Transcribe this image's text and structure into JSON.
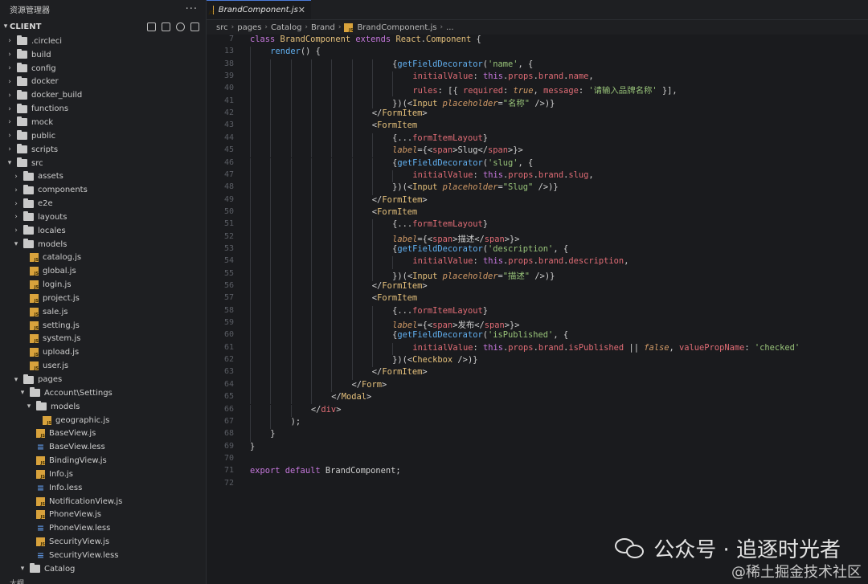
{
  "explorer": {
    "title": "资源管理器",
    "more": "···",
    "section": "CLIENT",
    "tree": [
      {
        "label": ".circleci",
        "type": "folder",
        "level": 0,
        "expanded": false
      },
      {
        "label": "build",
        "type": "folder",
        "level": 0,
        "expanded": false
      },
      {
        "label": "config",
        "type": "folder",
        "level": 0,
        "expanded": false
      },
      {
        "label": "docker",
        "type": "folder",
        "level": 0,
        "expanded": false
      },
      {
        "label": "docker_build",
        "type": "folder",
        "level": 0,
        "expanded": false
      },
      {
        "label": "functions",
        "type": "folder",
        "level": 0,
        "expanded": false
      },
      {
        "label": "mock",
        "type": "folder",
        "level": 0,
        "expanded": false
      },
      {
        "label": "public",
        "type": "folder",
        "level": 0,
        "expanded": false
      },
      {
        "label": "scripts",
        "type": "folder",
        "level": 0,
        "expanded": false
      },
      {
        "label": "src",
        "type": "folder",
        "level": 0,
        "expanded": true
      },
      {
        "label": "assets",
        "type": "folder",
        "level": 1,
        "expanded": false
      },
      {
        "label": "components",
        "type": "folder",
        "level": 1,
        "expanded": false
      },
      {
        "label": "e2e",
        "type": "folder",
        "level": 1,
        "expanded": false
      },
      {
        "label": "layouts",
        "type": "folder",
        "level": 1,
        "expanded": false
      },
      {
        "label": "locales",
        "type": "folder",
        "level": 1,
        "expanded": false
      },
      {
        "label": "models",
        "type": "folder",
        "level": 1,
        "expanded": true
      },
      {
        "label": "catalog.js",
        "type": "js",
        "level": 2
      },
      {
        "label": "global.js",
        "type": "js",
        "level": 2
      },
      {
        "label": "login.js",
        "type": "js",
        "level": 2
      },
      {
        "label": "project.js",
        "type": "js",
        "level": 2
      },
      {
        "label": "sale.js",
        "type": "js",
        "level": 2
      },
      {
        "label": "setting.js",
        "type": "js",
        "level": 2
      },
      {
        "label": "system.js",
        "type": "js",
        "level": 2
      },
      {
        "label": "upload.js",
        "type": "js",
        "level": 2
      },
      {
        "label": "user.js",
        "type": "js",
        "level": 2
      },
      {
        "label": "pages",
        "type": "folder",
        "level": 1,
        "expanded": true
      },
      {
        "label": "Account\\Settings",
        "type": "folder",
        "level": 2,
        "expanded": true
      },
      {
        "label": "models",
        "type": "folder",
        "level": 3,
        "expanded": true
      },
      {
        "label": "geographic.js",
        "type": "js",
        "level": 4
      },
      {
        "label": "BaseView.js",
        "type": "js",
        "level": 3
      },
      {
        "label": "BaseView.less",
        "type": "less",
        "level": 3
      },
      {
        "label": "BindingView.js",
        "type": "js",
        "level": 3
      },
      {
        "label": "Info.js",
        "type": "js",
        "level": 3
      },
      {
        "label": "Info.less",
        "type": "less",
        "level": 3
      },
      {
        "label": "NotificationView.js",
        "type": "js",
        "level": 3
      },
      {
        "label": "PhoneView.js",
        "type": "js",
        "level": 3
      },
      {
        "label": "PhoneView.less",
        "type": "less",
        "level": 3
      },
      {
        "label": "SecurityView.js",
        "type": "js",
        "level": 3
      },
      {
        "label": "SecurityView.less",
        "type": "less",
        "level": 3
      },
      {
        "label": "Catalog",
        "type": "folder",
        "level": 2,
        "expanded": true
      }
    ],
    "footer": "大纲"
  },
  "tab": {
    "label": "BrandComponent.js",
    "close": "✕"
  },
  "breadcrumb": [
    "src",
    "pages",
    "Catalog",
    "Brand",
    "BrandComponent.js",
    "..."
  ],
  "code": [
    {
      "n": "7",
      "i": 0,
      "t": [
        [
          "kw",
          "class "
        ],
        [
          "cls",
          "BrandComponent "
        ],
        [
          "kw",
          "extends "
        ],
        [
          "cls",
          "React"
        ],
        [
          "pl",
          "."
        ],
        [
          "cls",
          "Component "
        ],
        [
          "pl",
          "{"
        ]
      ]
    },
    {
      "n": "13",
      "i": 1,
      "t": [
        [
          "fn",
          "render"
        ],
        [
          "pl",
          "() {"
        ]
      ]
    },
    {
      "n": "38",
      "i": 7,
      "t": [
        [
          "pl",
          "{"
        ],
        [
          "fn",
          "getFieldDecorator"
        ],
        [
          "pl",
          "("
        ],
        [
          "str",
          "'name'"
        ],
        [
          "pl",
          ", {"
        ]
      ]
    },
    {
      "n": "39",
      "i": 8,
      "t": [
        [
          "prop",
          "initialValue"
        ],
        [
          "pl",
          ": "
        ],
        [
          "kw",
          "this"
        ],
        [
          "pl",
          "."
        ],
        [
          "prop",
          "props"
        ],
        [
          "pl",
          "."
        ],
        [
          "prop",
          "brand"
        ],
        [
          "pl",
          "."
        ],
        [
          "prop",
          "name"
        ],
        [
          "pl",
          ","
        ]
      ]
    },
    {
      "n": "40",
      "i": 8,
      "t": [
        [
          "prop",
          "rules"
        ],
        [
          "pl",
          ": [{ "
        ],
        [
          "prop",
          "required"
        ],
        [
          "pl",
          ": "
        ],
        [
          "attr",
          "true"
        ],
        [
          "pl",
          ", "
        ],
        [
          "prop",
          "message"
        ],
        [
          "pl",
          ": "
        ],
        [
          "str",
          "'请输入品牌名称'"
        ],
        [
          "pl",
          " }],"
        ]
      ]
    },
    {
      "n": "41",
      "i": 7,
      "t": [
        [
          "pl",
          "})(<"
        ],
        [
          "cls",
          "Input "
        ],
        [
          "attr",
          "placeholder"
        ],
        [
          "pl",
          "="
        ],
        [
          "str",
          "\"名称\""
        ],
        [
          "pl",
          " />)}"
        ]
      ]
    },
    {
      "n": "42",
      "i": 6,
      "t": [
        [
          "pl",
          "</"
        ],
        [
          "cls",
          "FormItem"
        ],
        [
          "pl",
          ">"
        ]
      ]
    },
    {
      "n": "43",
      "i": 6,
      "t": [
        [
          "pl",
          "<"
        ],
        [
          "cls",
          "FormItem"
        ]
      ]
    },
    {
      "n": "44",
      "i": 7,
      "t": [
        [
          "pl",
          "{..."
        ],
        [
          "prop",
          "formItemLayout"
        ],
        [
          "pl",
          "}"
        ]
      ]
    },
    {
      "n": "45",
      "i": 7,
      "t": [
        [
          "attr",
          "label"
        ],
        [
          "pl",
          "={<"
        ],
        [
          "tag",
          "span"
        ],
        [
          "pl",
          ">Slug</"
        ],
        [
          "tag",
          "span"
        ],
        [
          "pl",
          ">}>"
        ]
      ]
    },
    {
      "n": "46",
      "i": 7,
      "t": [
        [
          "pl",
          "{"
        ],
        [
          "fn",
          "getFieldDecorator"
        ],
        [
          "pl",
          "("
        ],
        [
          "str",
          "'slug'"
        ],
        [
          "pl",
          ", {"
        ]
      ]
    },
    {
      "n": "47",
      "i": 8,
      "t": [
        [
          "prop",
          "initialValue"
        ],
        [
          "pl",
          ": "
        ],
        [
          "kw",
          "this"
        ],
        [
          "pl",
          "."
        ],
        [
          "prop",
          "props"
        ],
        [
          "pl",
          "."
        ],
        [
          "prop",
          "brand"
        ],
        [
          "pl",
          "."
        ],
        [
          "prop",
          "slug"
        ],
        [
          "pl",
          ","
        ]
      ]
    },
    {
      "n": "48",
      "i": 7,
      "t": [
        [
          "pl",
          "})(<"
        ],
        [
          "cls",
          "Input "
        ],
        [
          "attr",
          "placeholder"
        ],
        [
          "pl",
          "="
        ],
        [
          "str",
          "\"Slug\""
        ],
        [
          "pl",
          " />)}"
        ]
      ]
    },
    {
      "n": "49",
      "i": 6,
      "t": [
        [
          "pl",
          "</"
        ],
        [
          "cls",
          "FormItem"
        ],
        [
          "pl",
          ">"
        ]
      ]
    },
    {
      "n": "50",
      "i": 6,
      "t": [
        [
          "pl",
          "<"
        ],
        [
          "cls",
          "FormItem"
        ]
      ]
    },
    {
      "n": "51",
      "i": 7,
      "t": [
        [
          "pl",
          "{..."
        ],
        [
          "prop",
          "formItemLayout"
        ],
        [
          "pl",
          "}"
        ]
      ]
    },
    {
      "n": "52",
      "i": 7,
      "t": [
        [
          "attr",
          "label"
        ],
        [
          "pl",
          "={<"
        ],
        [
          "tag",
          "span"
        ],
        [
          "pl",
          ">描述</"
        ],
        [
          "tag",
          "span"
        ],
        [
          "pl",
          ">}>"
        ]
      ]
    },
    {
      "n": "53",
      "i": 7,
      "t": [
        [
          "pl",
          "{"
        ],
        [
          "fn",
          "getFieldDecorator"
        ],
        [
          "pl",
          "("
        ],
        [
          "str",
          "'description'"
        ],
        [
          "pl",
          ", {"
        ]
      ]
    },
    {
      "n": "54",
      "i": 8,
      "t": [
        [
          "prop",
          "initialValue"
        ],
        [
          "pl",
          ": "
        ],
        [
          "kw",
          "this"
        ],
        [
          "pl",
          "."
        ],
        [
          "prop",
          "props"
        ],
        [
          "pl",
          "."
        ],
        [
          "prop",
          "brand"
        ],
        [
          "pl",
          "."
        ],
        [
          "prop",
          "description"
        ],
        [
          "pl",
          ","
        ]
      ]
    },
    {
      "n": "55",
      "i": 7,
      "t": [
        [
          "pl",
          "})(<"
        ],
        [
          "cls",
          "Input "
        ],
        [
          "attr",
          "placeholder"
        ],
        [
          "pl",
          "="
        ],
        [
          "str",
          "\"描述\""
        ],
        [
          "pl",
          " />)}"
        ]
      ]
    },
    {
      "n": "56",
      "i": 6,
      "t": [
        [
          "pl",
          "</"
        ],
        [
          "cls",
          "FormItem"
        ],
        [
          "pl",
          ">"
        ]
      ]
    },
    {
      "n": "57",
      "i": 6,
      "t": [
        [
          "pl",
          "<"
        ],
        [
          "cls",
          "FormItem"
        ]
      ]
    },
    {
      "n": "58",
      "i": 7,
      "t": [
        [
          "pl",
          "{..."
        ],
        [
          "prop",
          "formItemLayout"
        ],
        [
          "pl",
          "}"
        ]
      ]
    },
    {
      "n": "59",
      "i": 7,
      "t": [
        [
          "attr",
          "label"
        ],
        [
          "pl",
          "={<"
        ],
        [
          "tag",
          "span"
        ],
        [
          "pl",
          ">发布</"
        ],
        [
          "tag",
          "span"
        ],
        [
          "pl",
          ">}>"
        ]
      ]
    },
    {
      "n": "60",
      "i": 7,
      "t": [
        [
          "pl",
          "{"
        ],
        [
          "fn",
          "getFieldDecorator"
        ],
        [
          "pl",
          "("
        ],
        [
          "str",
          "'isPublished'"
        ],
        [
          "pl",
          ", {"
        ]
      ]
    },
    {
      "n": "61",
      "i": 8,
      "t": [
        [
          "prop",
          "initialValue"
        ],
        [
          "pl",
          ": "
        ],
        [
          "kw",
          "this"
        ],
        [
          "pl",
          "."
        ],
        [
          "prop",
          "props"
        ],
        [
          "pl",
          "."
        ],
        [
          "prop",
          "brand"
        ],
        [
          "pl",
          "."
        ],
        [
          "prop",
          "isPublished"
        ],
        [
          "pl",
          " || "
        ],
        [
          "attr",
          "false"
        ],
        [
          "pl",
          ", "
        ],
        [
          "prop",
          "valuePropName"
        ],
        [
          "pl",
          ": "
        ],
        [
          "str",
          "'checked'"
        ]
      ]
    },
    {
      "n": "62",
      "i": 7,
      "t": [
        [
          "pl",
          "})(<"
        ],
        [
          "cls",
          "Checkbox"
        ],
        [
          "pl",
          " />)}"
        ]
      ]
    },
    {
      "n": "63",
      "i": 6,
      "t": [
        [
          "pl",
          "</"
        ],
        [
          "cls",
          "FormItem"
        ],
        [
          "pl",
          ">"
        ]
      ]
    },
    {
      "n": "64",
      "i": 5,
      "t": [
        [
          "pl",
          "</"
        ],
        [
          "cls",
          "Form"
        ],
        [
          "pl",
          ">"
        ]
      ]
    },
    {
      "n": "65",
      "i": 4,
      "t": [
        [
          "pl",
          "</"
        ],
        [
          "cls",
          "Modal"
        ],
        [
          "pl",
          ">"
        ]
      ]
    },
    {
      "n": "66",
      "i": 3,
      "t": [
        [
          "pl",
          "</"
        ],
        [
          "tag",
          "div"
        ],
        [
          "pl",
          ">"
        ]
      ]
    },
    {
      "n": "67",
      "i": 2,
      "t": [
        [
          "pl",
          ");"
        ]
      ]
    },
    {
      "n": "68",
      "i": 1,
      "t": [
        [
          "pl",
          "}"
        ]
      ]
    },
    {
      "n": "69",
      "i": 0,
      "t": [
        [
          "pl",
          "}"
        ]
      ]
    },
    {
      "n": "70",
      "i": 0,
      "t": []
    },
    {
      "n": "71",
      "i": 0,
      "t": [
        [
          "kw",
          "export default "
        ],
        [
          "pl",
          "BrandComponent;"
        ]
      ]
    },
    {
      "n": "72",
      "i": 0,
      "t": []
    }
  ],
  "watermark": {
    "main": "公众号 · 追逐时光者",
    "sub": "@稀土掘金技术社区"
  },
  "colors": {
    "accent": "#4a7ad8",
    "folder": "#c9c9c9",
    "js": "#d8a23c",
    "less": "#5b8fd6"
  }
}
